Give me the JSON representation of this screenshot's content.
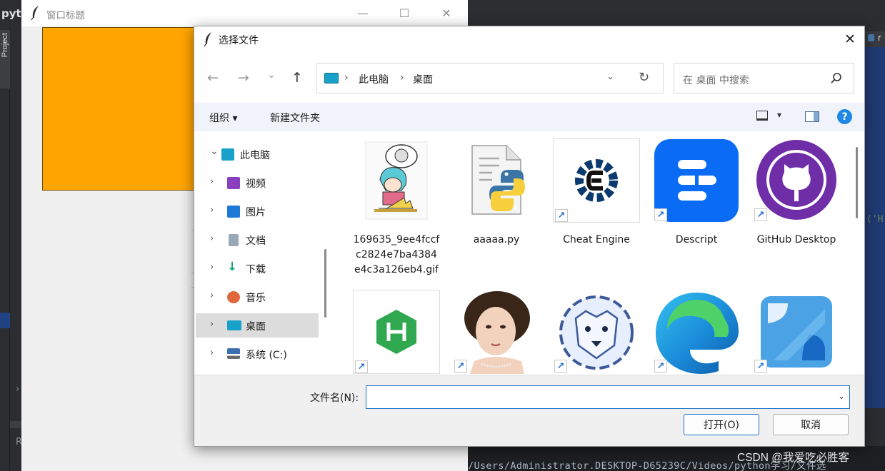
{
  "ide": {
    "logo_text": "pyt",
    "project_tab": "Project",
    "right_tab": "r",
    "code_fragment": "('H",
    "collapse_chevron": "›",
    "bottom_left_letter": "R",
    "terminal_path": "/Users/Administrator.DESKTOP-D65239C/Videos/python学习/文件选",
    "watermark": "CSDN @我爱吃必胜客"
  },
  "tk_window": {
    "title": "窗口标题",
    "controls": {
      "minimize": "—",
      "maximize": "☐",
      "close": "✕"
    },
    "canvas_color": "#ffa500"
  },
  "dialog": {
    "title": "选择文件",
    "close": "✕",
    "nav": {
      "back": "←",
      "forward": "→",
      "recent": "⌄",
      "up": "↑"
    },
    "address": {
      "segments": [
        "此电脑",
        "桌面"
      ],
      "separator": "›",
      "dropdown": "⌄",
      "refresh": "↻"
    },
    "search": {
      "placeholder": "在 桌面 中搜索"
    },
    "commands": {
      "organize": "组织 ▾",
      "new_folder": "新建文件夹",
      "view_dropdown": "▾",
      "help": "?"
    },
    "tree": [
      {
        "label": "此电脑",
        "expanded": true,
        "icon": "pc-icon",
        "color": "#19a2c9"
      },
      {
        "label": "视频",
        "icon": "video-icon",
        "color": "#8a3fbf"
      },
      {
        "label": "图片",
        "icon": "picture-icon",
        "color": "#1f7ad6"
      },
      {
        "label": "文档",
        "icon": "document-icon",
        "color": "#9aa7b8"
      },
      {
        "label": "下载",
        "icon": "download-icon",
        "color": "#1aa37a"
      },
      {
        "label": "音乐",
        "icon": "music-icon",
        "color": "#e0673a"
      },
      {
        "label": "桌面",
        "icon": "desktop-icon",
        "color": "#19a2c9",
        "selected": true
      },
      {
        "label": "系统 (C:)",
        "icon": "drive-icon",
        "color": "#3c6fb0"
      }
    ],
    "tree_chevrons": {
      "expanded": "⌄",
      "collapsed": "›"
    },
    "files": [
      {
        "name": "169635_9ee4fccfc2824e7ba4384e4c3a126eb4.gif",
        "type": "gif"
      },
      {
        "name": "aaaaa.py",
        "type": "python"
      },
      {
        "name": "Cheat Engine",
        "type": "shortcut"
      },
      {
        "name": "Descript",
        "type": "shortcut"
      },
      {
        "name": "GitHub Desktop",
        "type": "shortcut"
      },
      {
        "name": "",
        "type": "shortcut-hbuilder"
      },
      {
        "name": "",
        "type": "shortcut-portrait"
      },
      {
        "name": "",
        "type": "shortcut-cheetah"
      },
      {
        "name": "",
        "type": "shortcut-edge"
      },
      {
        "name": "",
        "type": "shortcut-blue"
      }
    ],
    "shortcut_arrow": "↗",
    "filename": {
      "label": "文件名(N):",
      "value": "",
      "dropdown": "⌄"
    },
    "buttons": {
      "open": "打开(O)",
      "cancel": "取消"
    }
  }
}
